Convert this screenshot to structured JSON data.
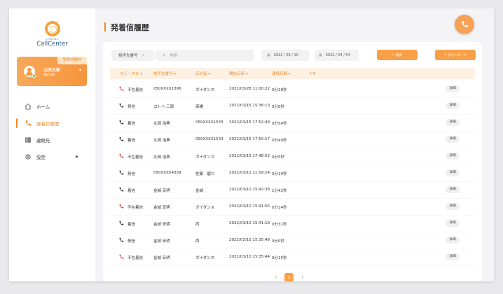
{
  "brand": {
    "small": "CORONA",
    "name": "CallCenter"
  },
  "user": {
    "badge": "受発待機中",
    "name": "山田太郎",
    "status": "通話可能"
  },
  "nav": [
    {
      "label": "ホーム",
      "icon": "home-icon"
    },
    {
      "label": "発着信履歴",
      "icon": "phone-icon"
    },
    {
      "label": "連絡先",
      "icon": "list-icon"
    },
    {
      "label": "設定",
      "icon": "gear-icon"
    }
  ],
  "page": {
    "title": "発着信履歴"
  },
  "filters": {
    "type": "相手先番号",
    "search_placeholder": "検索",
    "date_from": "2022 / 03 / 10",
    "date_sep": "-",
    "date_to": "2022 / 04 / 04",
    "search_btn": "検索",
    "download_btn": "ダウンロード"
  },
  "table": {
    "headers": [
      "ステータス",
      "相手先番号",
      "応対者",
      "開始日時",
      "通話時間",
      "メモ"
    ],
    "detail_label": "詳細",
    "rows": [
      {
        "type": "missed",
        "status": "不在着信",
        "number": "050XXXX1396",
        "agent": "ガイダンス",
        "start": "2022/03/28 11:00:22",
        "duration": "0分28秒"
      },
      {
        "type": "out",
        "status": "発信",
        "number": "コトハ 三厚",
        "agent": "高橋",
        "start": "2022/03/15 15:36:13",
        "duration": "0分0秒"
      },
      {
        "type": "in",
        "status": "着信",
        "number": "丸岡 浩典",
        "agent": "050XXXX1533",
        "start": "2022/03/15 17:52:49",
        "duration": "0分54秒"
      },
      {
        "type": "in",
        "status": "着信",
        "number": "丸岡 浩典",
        "agent": "050XXXX1533",
        "start": "2022/03/15 17:50:17",
        "duration": "0分49秒"
      },
      {
        "type": "missed",
        "status": "不在着信",
        "number": "丸岡 浩典",
        "agent": "ガイダンス",
        "start": "2022/03/15 17:48:52",
        "duration": "0分5秒"
      },
      {
        "type": "out",
        "status": "発信",
        "number": "050XXXX4339",
        "agent": "佐藤　碧仁",
        "start": "2022/03/11 11:09:14",
        "duration": "0分10秒"
      },
      {
        "type": "in",
        "status": "着信",
        "number": "金城 宏明",
        "agent": "金城",
        "start": "2022/03/10 15:42:38",
        "duration": "1分42秒"
      },
      {
        "type": "missed",
        "status": "不在着信",
        "number": "金城 宏明",
        "agent": "ガイダンス",
        "start": "2022/03/10 15:41:56",
        "duration": "0分14秒"
      },
      {
        "type": "in",
        "status": "着信",
        "number": "金城 宏明",
        "agent": "西",
        "start": "2022/03/10 15:41:19",
        "duration": "0分31秒"
      },
      {
        "type": "out",
        "status": "発信",
        "number": "金城 宏明",
        "agent": "西",
        "start": "2022/03/10 15:35:48",
        "duration": "0分0秒"
      },
      {
        "type": "missed",
        "status": "不在着信",
        "number": "金城 宏明",
        "agent": "ガイダンス",
        "start": "2022/03/10 15:35:44",
        "duration": "0分15秒"
      }
    ]
  },
  "pager": {
    "prev": "‹",
    "current": "1",
    "next": "›"
  },
  "colors": {
    "accent": "#f6953c",
    "missed": "#e0393e",
    "normal": "#2d3440"
  }
}
